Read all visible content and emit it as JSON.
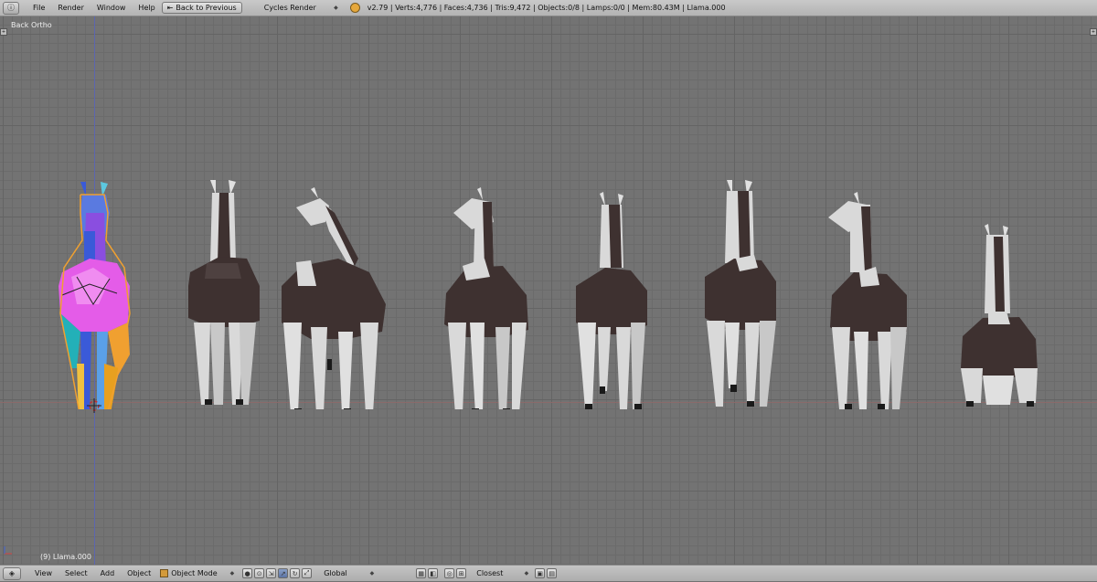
{
  "top_bar": {
    "editor_icon": "info-icon",
    "menus": [
      "File",
      "Render",
      "Window",
      "Help"
    ],
    "back_button": "Back to Previous",
    "engine": "Cycles Render",
    "stats": "v2.79 | Verts:4,776 | Faces:4,736 | Tris:9,472 | Objects:0/8 | Lamps:0/0 | Mem:80.43M | Llama.000"
  },
  "viewport": {
    "view_name": "Back Ortho",
    "object_info": "(9) Llama.000"
  },
  "bottom_bar": {
    "menus": [
      "View",
      "Select",
      "Add",
      "Object"
    ],
    "mode": "Object Mode",
    "orientation": "Global",
    "snap_target": "Closest"
  },
  "colors": {
    "llama_dark": "#3e3130",
    "llama_light": "#d9d9d9",
    "uv_test_magenta": "#e45ce8",
    "uv_test_blue": "#3a5ad8",
    "selection_orange": "#f0a030"
  }
}
